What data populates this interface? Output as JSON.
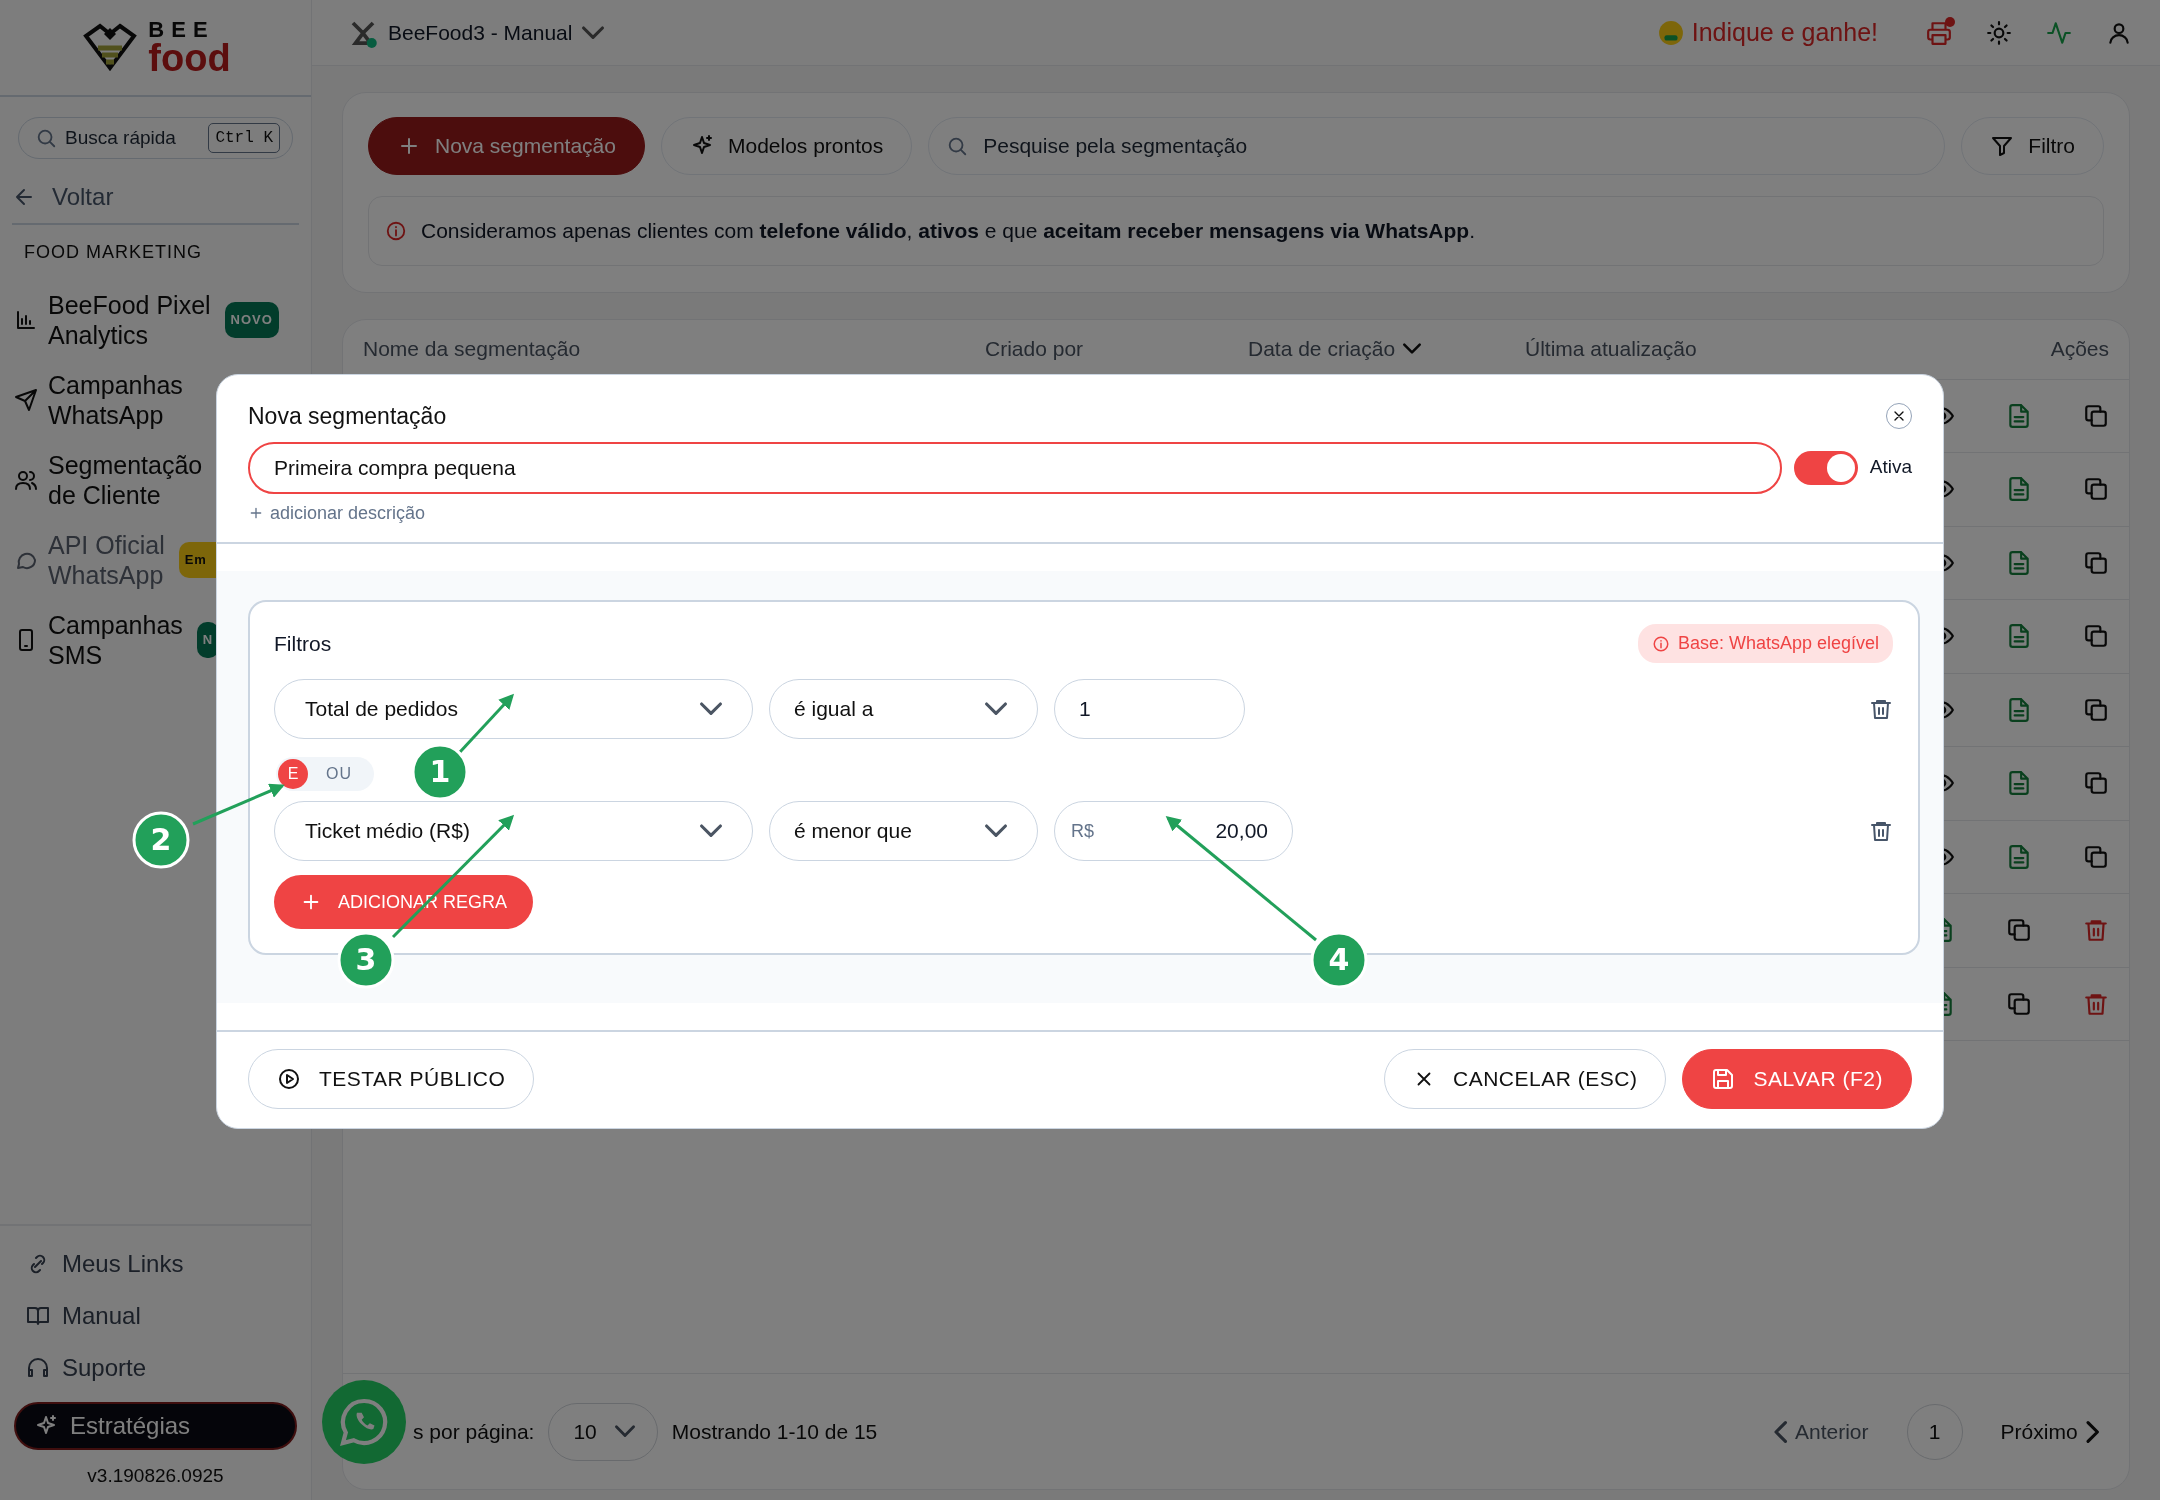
{
  "sidebar": {
    "logo": {
      "line1": "BEE",
      "line2": "food"
    },
    "search": {
      "placeholder": "Busca rápida",
      "shortcut": "Ctrl K"
    },
    "back": "Voltar",
    "section": "FOOD MARKETING",
    "items": [
      {
        "lines": [
          "BeeFood Pixel",
          "Analytics"
        ],
        "badge": {
          "text": "NOVO",
          "kind": "new"
        },
        "disabled": false
      },
      {
        "lines": [
          "Campanhas",
          "WhatsApp"
        ],
        "disabled": false
      },
      {
        "lines": [
          "Segmentação",
          "de Cliente"
        ],
        "disabled": false
      },
      {
        "lines": [
          "API Oficial",
          "WhatsApp"
        ],
        "badge": {
          "text": "Em",
          "kind": "soon"
        },
        "disabled": true
      },
      {
        "lines": [
          "Campanhas",
          "SMS"
        ],
        "badge": {
          "text": "N",
          "kind": "new"
        },
        "disabled": false
      }
    ],
    "footer_links": [
      "Meus Links",
      "Manual",
      "Suporte"
    ],
    "strategies_button": "Estratégias",
    "version": "v3.190826.0925"
  },
  "topbar": {
    "store": "BeeFood3 - Manual",
    "referral": "Indique e ganhe!",
    "printer_alert": true
  },
  "toolbar": {
    "new_button": "Nova segmentação",
    "templates_button": "Modelos prontos",
    "search_placeholder": "Pesquise pela segmentação",
    "filter_button": "Filtro",
    "notice": "Consideramos apenas clientes com **telefone válido**, **ativos** e que **aceitam receber mensagens via WhatsApp**."
  },
  "table": {
    "columns": [
      {
        "label": "Nome da segmentação",
        "sortable": false
      },
      {
        "label": "Criado por",
        "sortable": false
      },
      {
        "label": "Data de criação",
        "sortable": true
      },
      {
        "label": "Última atualização",
        "sortable": false
      },
      {
        "label": "Ações",
        "sortable": false
      }
    ],
    "rows": [
      {
        "kind": "viewable"
      },
      {
        "kind": "viewable"
      },
      {
        "kind": "viewable"
      },
      {
        "kind": "viewable"
      },
      {
        "kind": "viewable"
      },
      {
        "kind": "viewable"
      },
      {
        "kind": "viewable"
      },
      {
        "kind": "deletable"
      },
      {
        "kind": "deletable"
      }
    ]
  },
  "pagination": {
    "per_page_label": "s por página:",
    "per_page": "10",
    "summary": "Mostrando 1-10 de 15",
    "previous": "Anterior",
    "previous_disabled": true,
    "page": "1",
    "next": "Próximo"
  },
  "modal": {
    "title": "Nova segmentação",
    "name_value": "Primeira compra pequena",
    "active": true,
    "active_label": "Ativa",
    "add_description": "adicionar descrição",
    "filters": {
      "title": "Filtros",
      "base_badge": "Base: WhatsApp elegível",
      "rules": [
        {
          "field": "Total de pedidos",
          "operator": "é igual a",
          "value": "1"
        },
        {
          "field": "Ticket médio (R$)",
          "operator": "é menor que",
          "prefix": "R$",
          "value": "20,00"
        }
      ],
      "connector": [
        {
          "label": "E",
          "selected": true
        },
        {
          "label": "OU",
          "selected": false
        }
      ],
      "add_rule": "ADICIONAR REGRA"
    },
    "test_button": "TESTAR PÚBLICO",
    "cancel_button": "CANCELAR (ESC)",
    "save_button": "SALVAR (F2)"
  },
  "annotations": [
    {
      "label": "1"
    },
    {
      "label": "2"
    },
    {
      "label": "3"
    },
    {
      "label": "4"
    }
  ]
}
